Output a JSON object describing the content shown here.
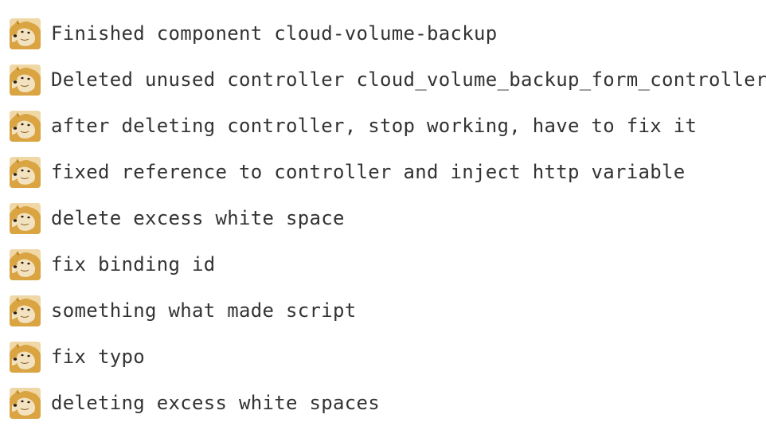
{
  "commits": [
    {
      "message": "Finished component cloud-volume-backup",
      "avatar": "doge-avatar"
    },
    {
      "message": "Deleted unused controller cloud_volume_backup_form_controller",
      "avatar": "doge-avatar"
    },
    {
      "message": "after deleting controller, stop working, have to fix it",
      "avatar": "doge-avatar"
    },
    {
      "message": "fixed reference to controller and inject http variable",
      "avatar": "doge-avatar"
    },
    {
      "message": "delete excess white space",
      "avatar": "doge-avatar"
    },
    {
      "message": "fix binding id",
      "avatar": "doge-avatar"
    },
    {
      "message": "something what made script",
      "avatar": "doge-avatar"
    },
    {
      "message": "fix typo",
      "avatar": "doge-avatar"
    },
    {
      "message": "deleting excess white spaces",
      "avatar": "doge-avatar"
    }
  ],
  "colors": {
    "text": "#333333",
    "avatar_fur": "#d9a441",
    "avatar_face": "#f3e2bf",
    "background": "#ffffff"
  }
}
